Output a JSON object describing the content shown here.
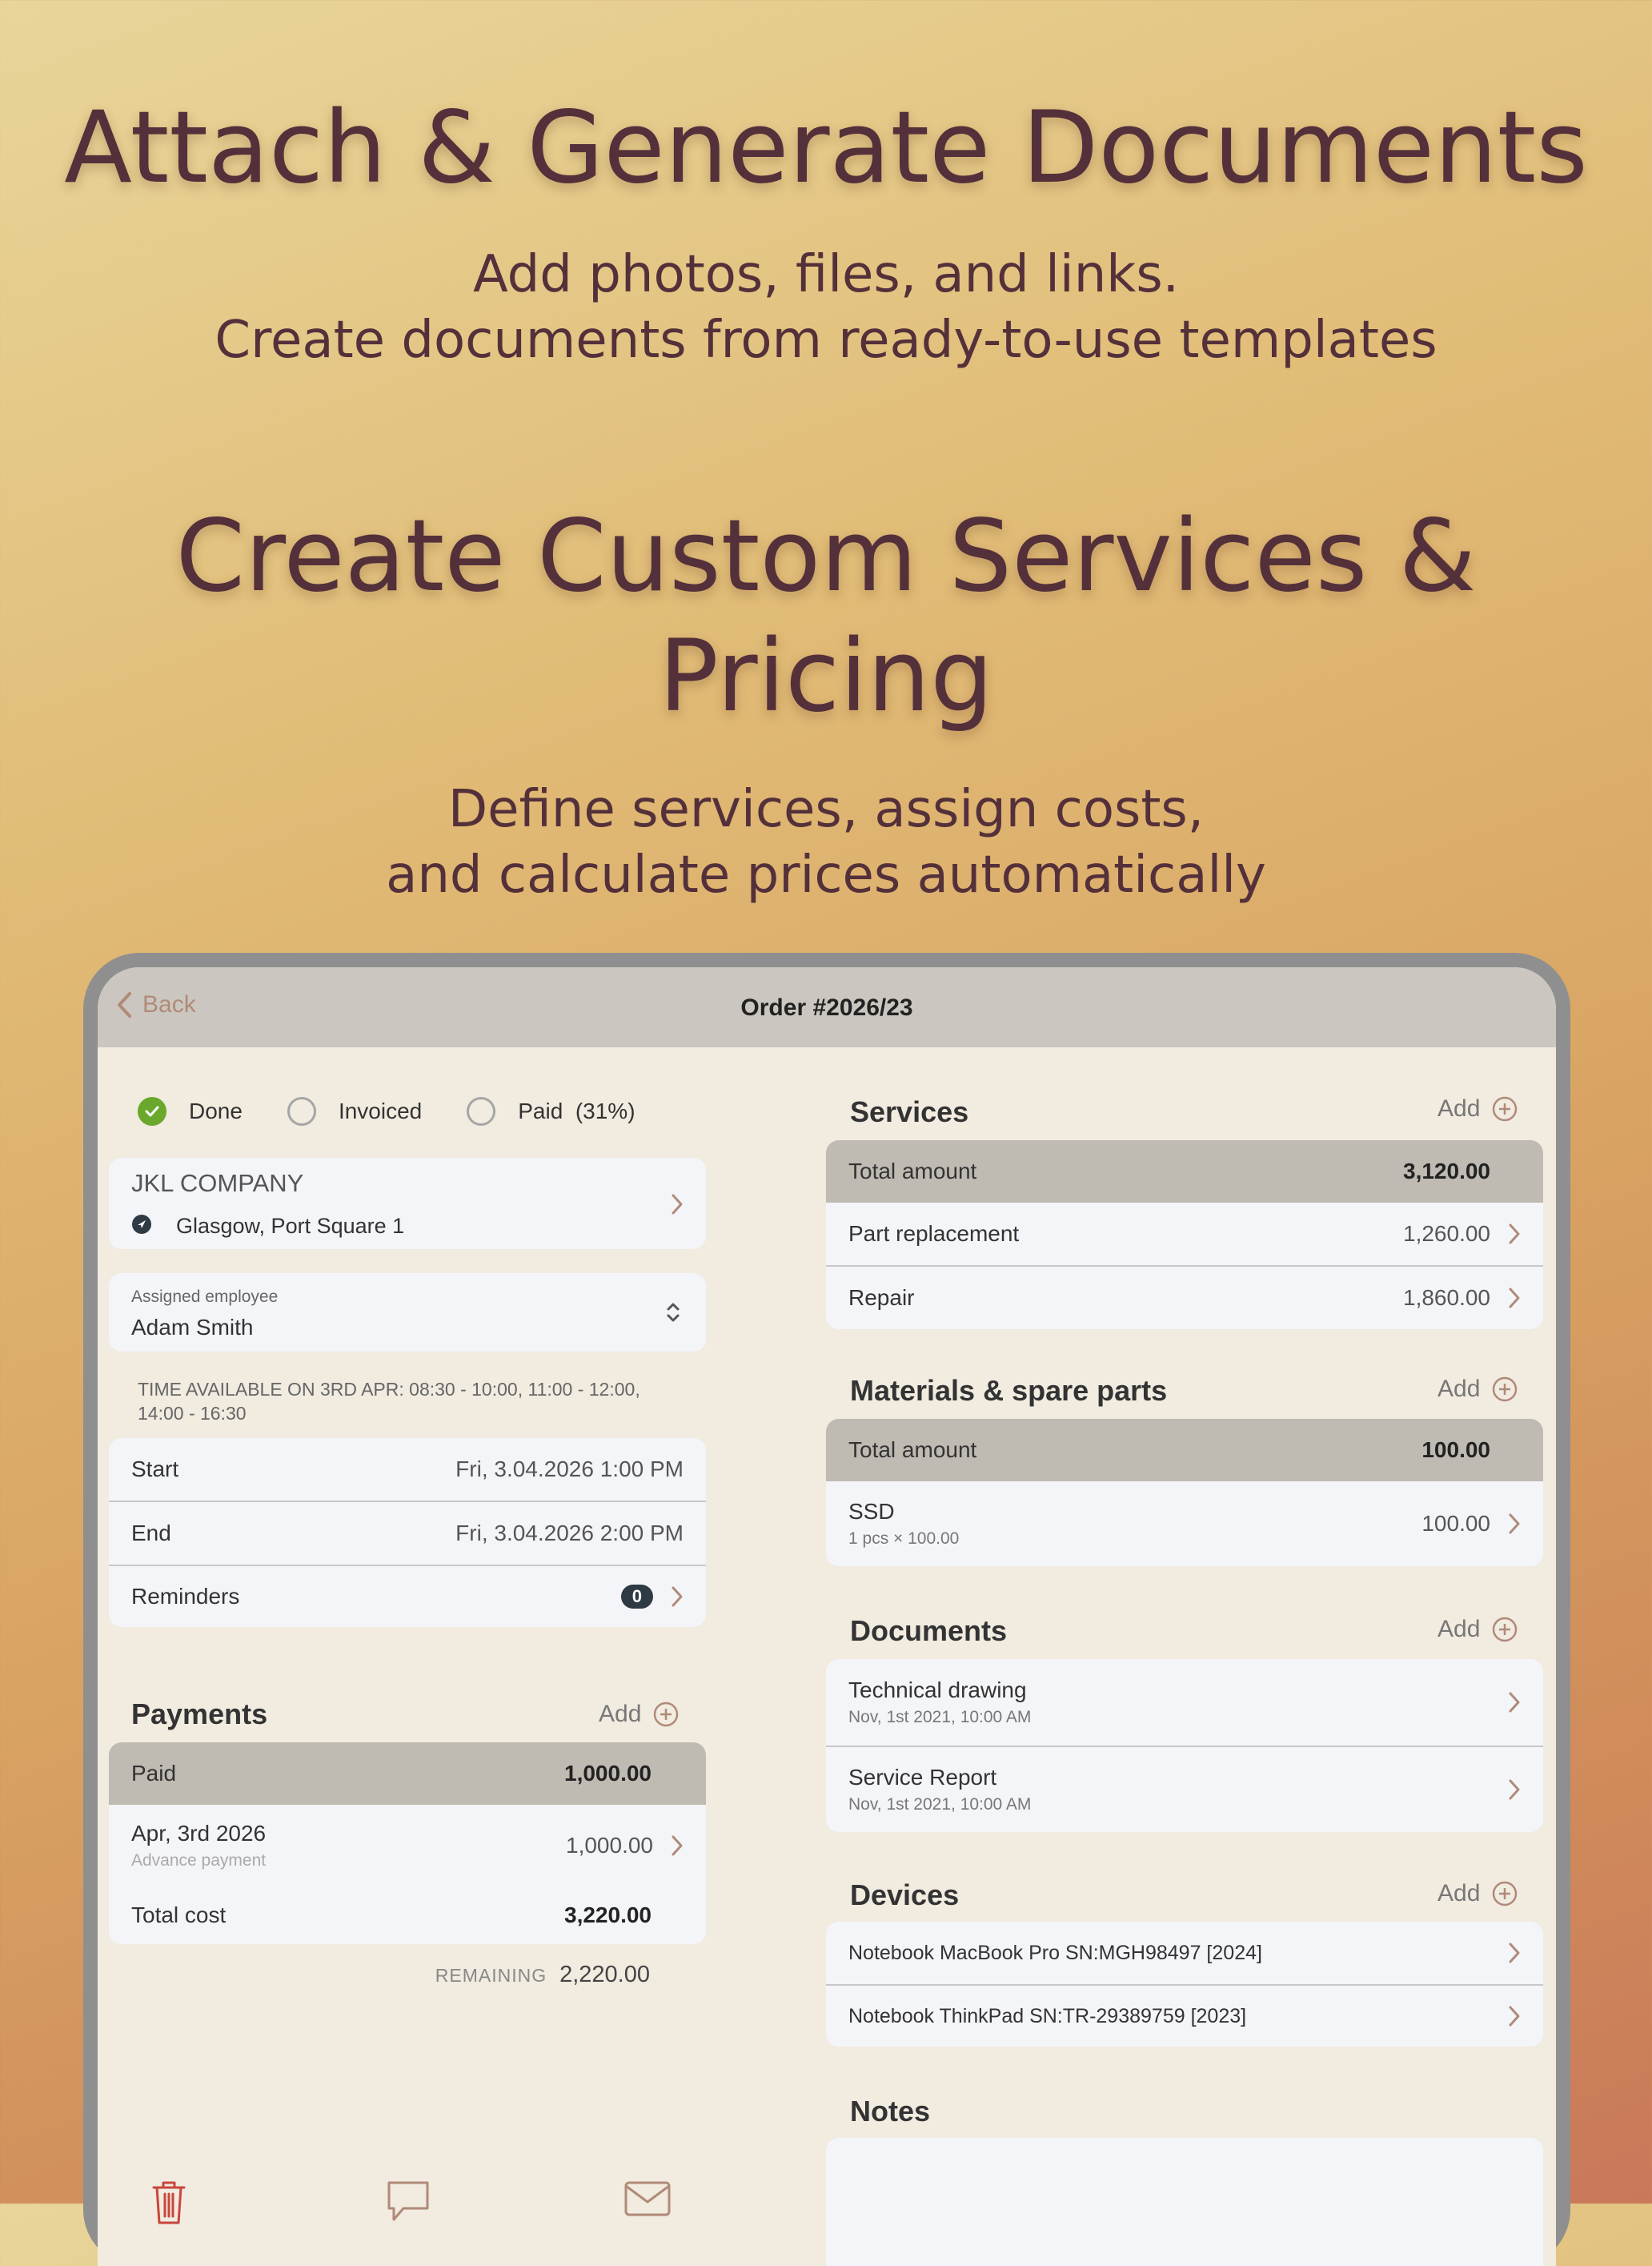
{
  "hero": {
    "title1": "Attach & Generate Documents",
    "subtitle1_line1": "Add photos, files, and links.",
    "subtitle1_line2": "Create documents from ready-to-use templates",
    "title2_line1": "Create Custom Services &",
    "title2_line2": "Pricing",
    "subtitle2_line1": "Define services, assign costs,",
    "subtitle2_line2": "and calculate prices automatically"
  },
  "nav": {
    "back_label": "Back",
    "title": "Order #2026/23"
  },
  "status": {
    "done": "Done",
    "invoiced": "Invoiced",
    "paid": "Paid  (31%)"
  },
  "customer": {
    "name": "JKL COMPANY",
    "address": "Glasgow, Port Square 1"
  },
  "employee": {
    "label": "Assigned employee",
    "name": "Adam Smith"
  },
  "availability": "TIME AVAILABLE ON 3RD APR: 08:30 - 10:00, 11:00 - 12:00, 14:00 - 16:30",
  "schedule": {
    "start_label": "Start",
    "start_value": "Fri, 3.04.2026 1:00 PM",
    "end_label": "End",
    "end_value": "Fri, 3.04.2026 2:00 PM",
    "reminders_label": "Reminders",
    "reminders_count": "0"
  },
  "payments": {
    "title": "Payments",
    "add_label": "Add",
    "paid_label": "Paid",
    "paid_value": "1,000.00",
    "entry_date": "Apr, 3rd 2026",
    "entry_note": "Advance payment",
    "entry_value": "1,000.00",
    "total_cost_label": "Total cost",
    "total_cost_value": "3,220.00",
    "remaining_label": "REMAINING",
    "remaining_value": "2,220.00"
  },
  "services": {
    "title": "Services",
    "add_label": "Add",
    "total_label": "Total amount",
    "total_value": "3,120.00",
    "items": [
      {
        "name": "Part replacement",
        "value": "1,260.00"
      },
      {
        "name": "Repair",
        "value": "1,860.00"
      }
    ]
  },
  "materials": {
    "title": "Materials & spare parts",
    "add_label": "Add",
    "total_label": "Total amount",
    "total_value": "100.00",
    "item_name": "SSD",
    "item_detail": "1 pcs × 100.00",
    "item_value": "100.00"
  },
  "documents": {
    "title": "Documents",
    "add_label": "Add",
    "items": [
      {
        "name": "Technical drawing",
        "date": "Nov, 1st 2021, 10:00 AM"
      },
      {
        "name": "Service Report",
        "date": "Nov, 1st 2021, 10:00 AM"
      }
    ]
  },
  "devices": {
    "title": "Devices",
    "add_label": "Add",
    "items": [
      {
        "name": "Notebook MacBook Pro SN:MGH98497 [2024]"
      },
      {
        "name": "Notebook ThinkPad SN:TR-29389759 [2023]"
      }
    ]
  },
  "notes": {
    "title": "Notes"
  },
  "colors": {
    "accent": "#b08a78",
    "done_green": "#6aa82c",
    "danger": "#c9463d",
    "hero_text": "#54303a"
  },
  "icons": [
    "chevron-left-icon",
    "check-icon",
    "location-arrow-icon",
    "chevron-right-icon",
    "updown-chevron-icon",
    "plus-circle-icon",
    "trash-icon",
    "chat-bubble-icon",
    "mail-icon"
  ]
}
